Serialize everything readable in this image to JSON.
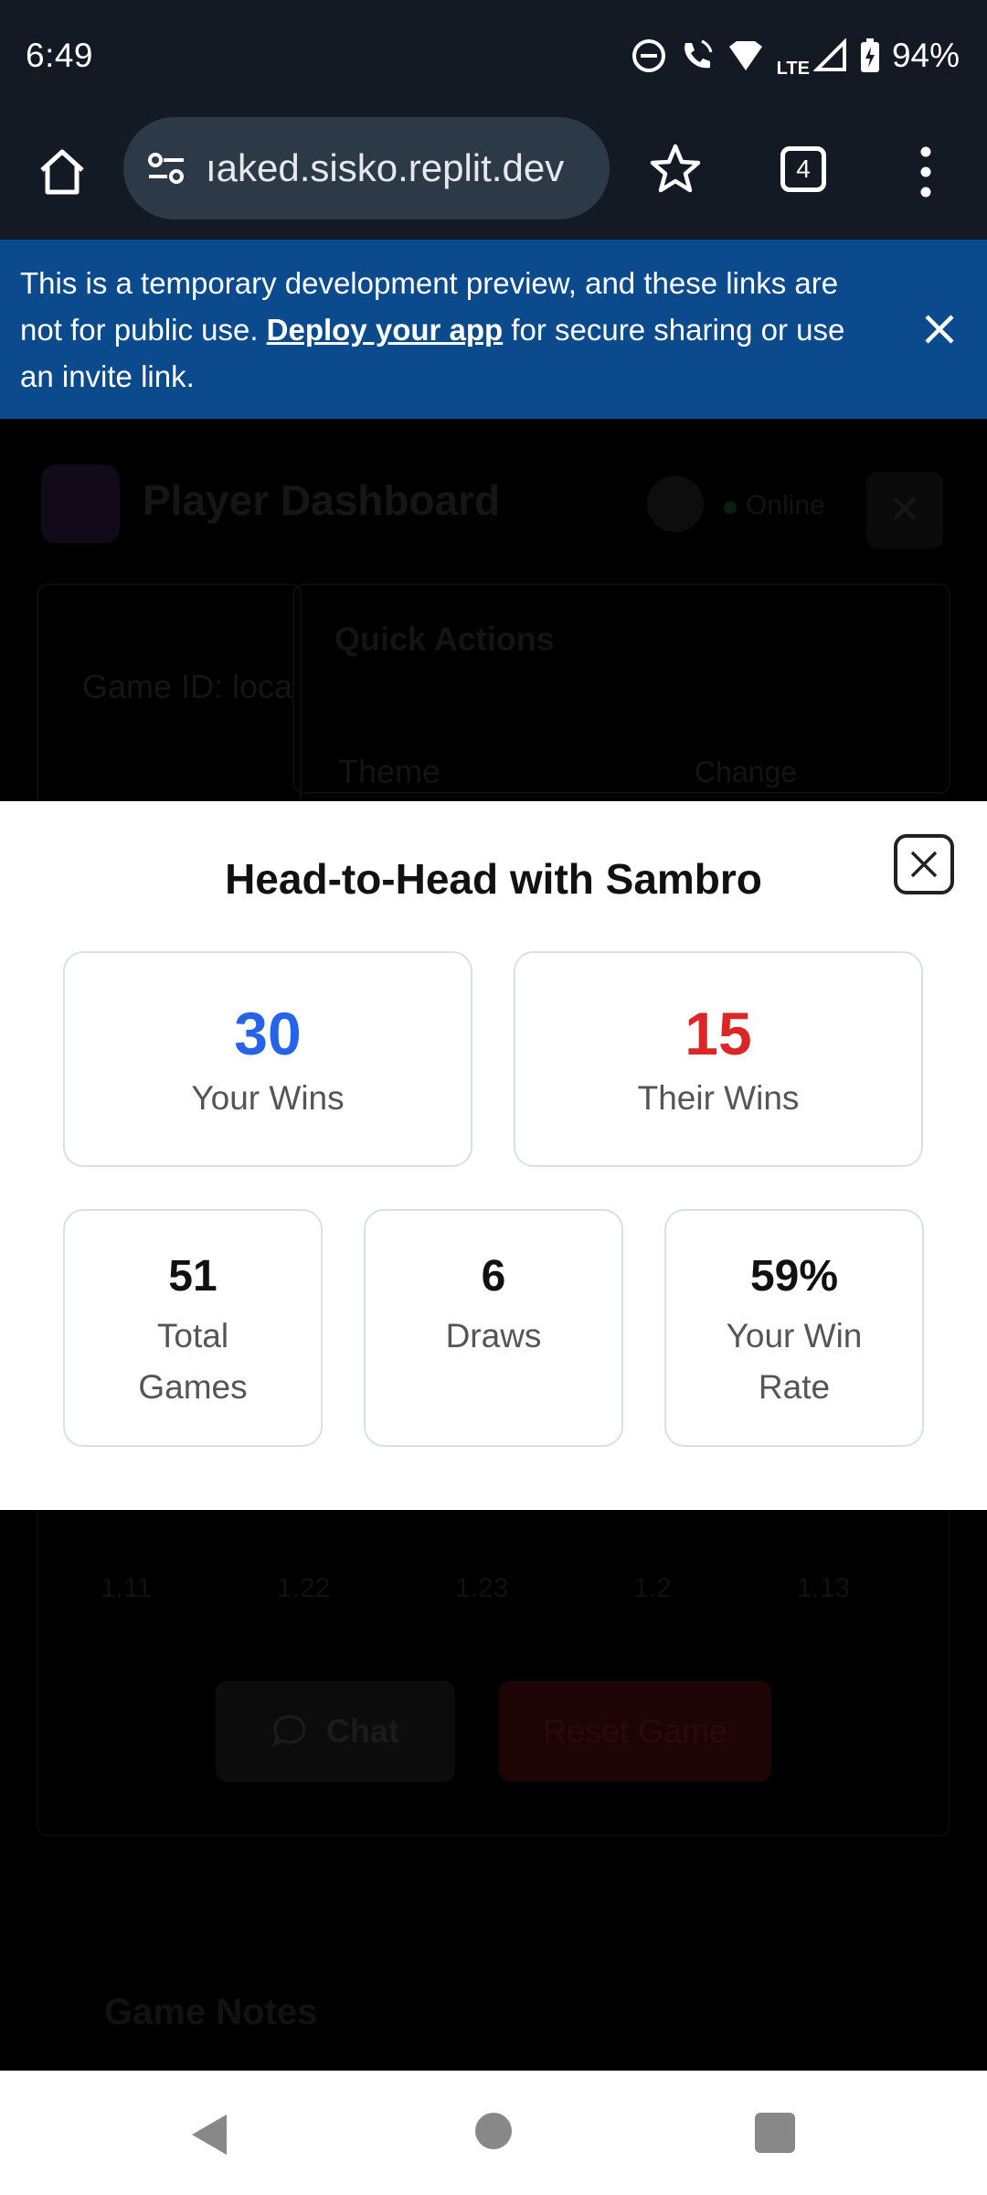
{
  "status_bar": {
    "time": "6:49",
    "network": "LTE",
    "battery": "94%"
  },
  "browser": {
    "url": "ıaked.sisko.replit.dev",
    "tab_count": "4"
  },
  "banner": {
    "text_before": "This is a temporary development preview, and these links are not for public use. ",
    "link_text": "Deploy your app",
    "text_after": " for secure sharing or use an invite link."
  },
  "background_app": {
    "title": "Player Dashboard",
    "status": "Online",
    "game_id": "Game ID: loca",
    "quick_actions": "Quick Actions",
    "theme_label": "Theme",
    "change_label": "Change",
    "scores": [
      "1.11",
      "1.22",
      "1.23",
      "1.2",
      "1.13"
    ],
    "chat_label": "Chat",
    "reset_label": "Reset Game",
    "notes_heading": "Game Notes"
  },
  "modal": {
    "title": "Head-to-Head with Sambro",
    "your_wins": {
      "value": "30",
      "label": "Your Wins",
      "color": "#2563eb"
    },
    "their_wins": {
      "value": "15",
      "label": "Their Wins",
      "color": "#dc2626"
    },
    "total_games": {
      "value": "51",
      "label": "Total Games"
    },
    "draws": {
      "value": "6",
      "label": "Draws"
    },
    "win_rate": {
      "value": "59%",
      "label": "Your Win Rate"
    }
  }
}
